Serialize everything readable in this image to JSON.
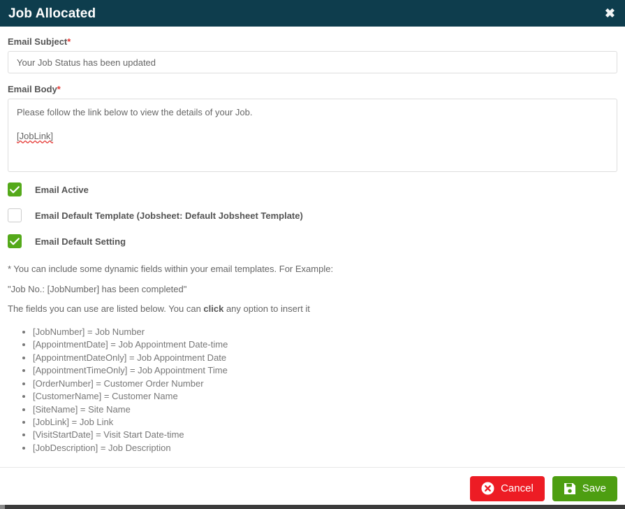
{
  "header": {
    "title": "Job Allocated",
    "close_label": "✖"
  },
  "form": {
    "subject": {
      "label": "Email Subject",
      "required_mark": "*",
      "value": "Your Job Status has been updated"
    },
    "body": {
      "label": "Email Body",
      "required_mark": "*",
      "line1": "Please follow the link below to view the details of your Job.",
      "line2": "[JobLink]"
    }
  },
  "checkboxes": [
    {
      "label": "Email Active",
      "checked": true
    },
    {
      "label": "Email Default Template (Jobsheet: Default Jobsheet Template)",
      "checked": false
    },
    {
      "label": "Email Default Setting",
      "checked": true
    }
  ],
  "help": {
    "line1": "* You can include some dynamic fields within your email templates. For Example:",
    "line2": "\"Job No.: [JobNumber] has been completed\"",
    "line3_pre": "The fields you can use are listed below. You can ",
    "line3_bold": "click",
    "line3_post": " any option to insert it",
    "fields": [
      "[JobNumber] = Job Number",
      "[AppointmentDate] = Job Appointment Date-time",
      "[AppointmentDateOnly] = Job Appointment Date",
      "[AppointmentTimeOnly] = Job Appointment Time",
      "[OrderNumber] = Customer Order Number",
      "[CustomerName] = Customer Name",
      "[SiteName] = Site Name",
      "[JobLink] = Job Link",
      "[VisitStartDate] = Visit Start Date-time",
      "[JobDescription] = Job Description"
    ]
  },
  "footer": {
    "cancel_label": "Cancel",
    "save_label": "Save"
  },
  "colors": {
    "header_bg": "#0e3d4d",
    "checkbox_green": "#54a91a",
    "cancel_red": "#ed1c24",
    "save_green": "#4d9e11",
    "required_red": "#e53935"
  }
}
